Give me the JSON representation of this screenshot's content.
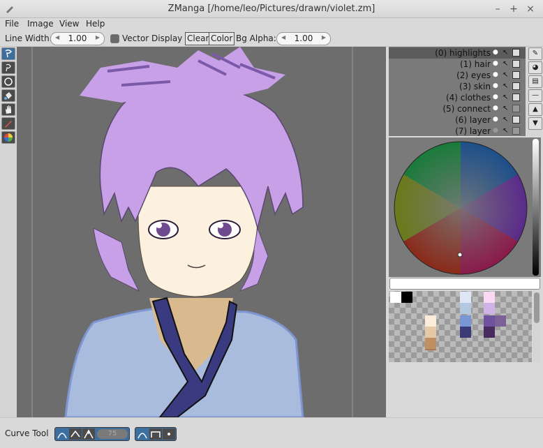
{
  "window": {
    "title": "ZManga [/home/leo/Pictures/drawn/violet.zm]",
    "controls": [
      "–",
      "+",
      "×"
    ]
  },
  "menu": [
    "File",
    "Image",
    "View",
    "Help"
  ],
  "toolbar": {
    "line_width_label": "Line Width:",
    "line_width_value": "1.00",
    "vector_display_label": "Vector Display",
    "clear_label": "Clear",
    "color_label": "Color",
    "bg_alpha_label": "Bg Alpha:",
    "bg_alpha_value": "1.00"
  },
  "tools": [
    "lasso-icon",
    "lasso-outline-icon",
    "circle-icon",
    "fill-icon",
    "hand-icon",
    "pen-icon",
    "color-wheel-icon"
  ],
  "layers": [
    {
      "label": "(0) highlights",
      "selected": true
    },
    {
      "label": "(1) hair"
    },
    {
      "label": "(2) eyes"
    },
    {
      "label": "(3) skin"
    },
    {
      "label": "(4) clothes"
    },
    {
      "label": "(5) connect"
    },
    {
      "label": "(6) layer"
    },
    {
      "label": "(7) layer"
    }
  ],
  "color_field_value": "",
  "swatches": [
    "#ffffff",
    "#000000",
    "#dfe6f5",
    "#f9d9f4",
    "#b5c8e2",
    "#cfb2e6",
    "#fcebd8",
    "#7b96d6",
    "#6e52a0",
    "#7a6296",
    "#e5c9a7",
    "#3b3b78",
    "#482c60",
    "#c09060",
    "#ac7a55"
  ],
  "status": {
    "tool_label": "Curve Tool",
    "value": "75"
  },
  "colors": {
    "accent": "#3c6ea0",
    "canvas": "#6d6d6d",
    "hair": "#c8a0e8",
    "skin": "#fcf1df",
    "robe": "#a9bcdd"
  }
}
